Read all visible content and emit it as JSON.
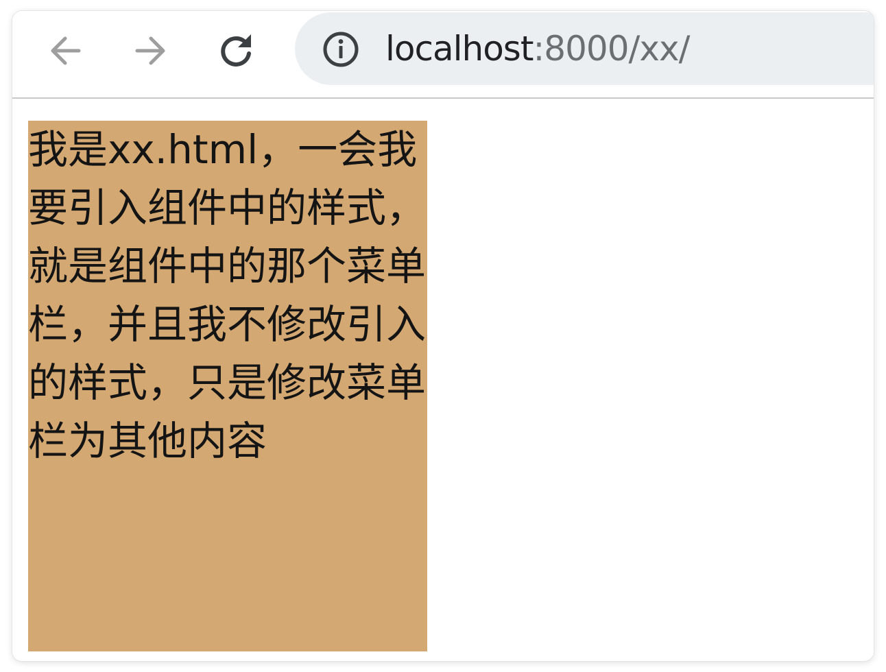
{
  "browser": {
    "back_icon": "arrow-left-icon",
    "forward_icon": "arrow-right-icon",
    "reload_icon": "reload-icon",
    "site_info_icon": "info-circle-icon",
    "address": {
      "host": "localhost",
      "rest": ":8000/xx/"
    },
    "colors": {
      "omnibox_bg": "#eceff1",
      "url_host": "#202124",
      "url_rest": "#6b6f73"
    }
  },
  "page": {
    "box_color": "#d4a872",
    "text": "我是xx.html，一会我要引入组件中的样式，就是组件中的那个菜单栏，并且我不修改引入的样式，只是修改菜单栏为其他内容"
  }
}
